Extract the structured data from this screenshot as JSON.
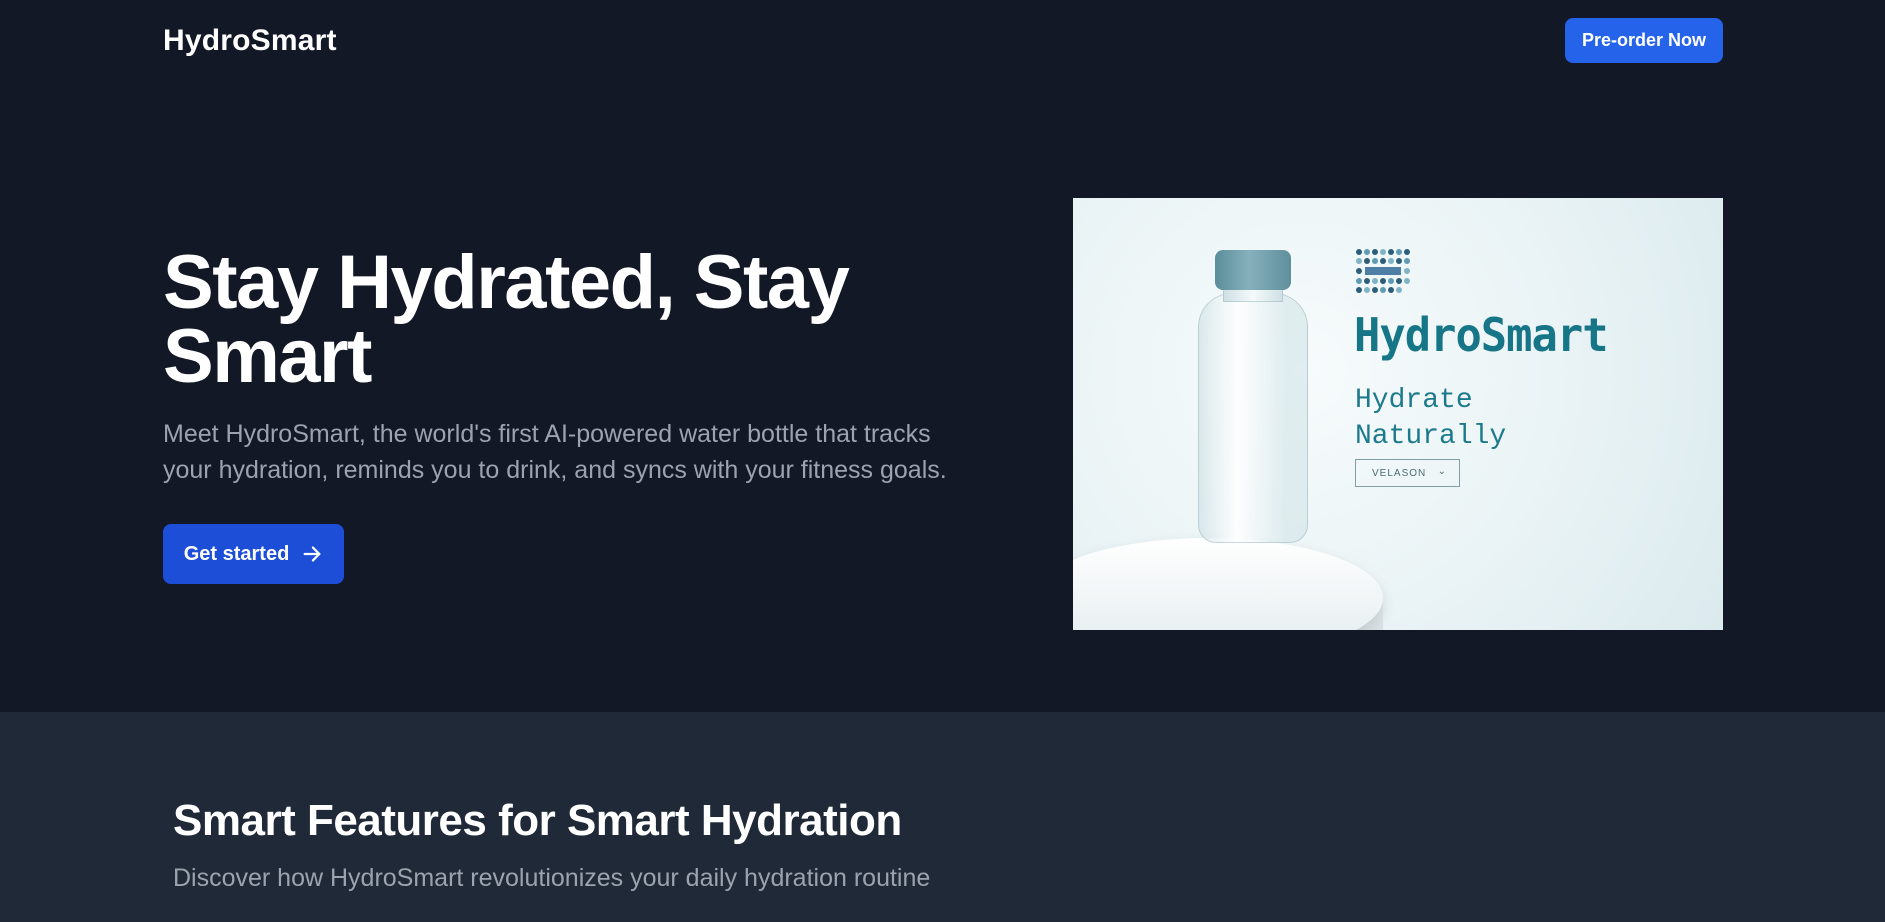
{
  "header": {
    "brand": "HydroSmart",
    "preorder_label": "Pre-order Now"
  },
  "hero": {
    "title": "Stay Hydrated, Stay Smart",
    "subtitle": "Meet HydroSmart, the world's first AI-powered water bottle that tracks your hydration, reminds you to drink, and syncs with your fitness goals.",
    "cta_label": "Get started",
    "cta_icon": "arrow-right-icon",
    "image": {
      "brand": "HydroSmart",
      "tagline_line1": "Hydrate",
      "tagline_line2": "Naturally",
      "select_value": "VELASON"
    }
  },
  "features": {
    "title": "Smart Features for Smart Hydration",
    "subtitle": "Discover how HydroSmart revolutionizes your daily hydration routine"
  },
  "colors": {
    "page_bg": "#121826",
    "section_bg": "#1f2937",
    "primary": "#2563eb",
    "primary_dark": "#1d4ed8",
    "muted_text": "#9ca3af",
    "image_brand": "#167587"
  }
}
